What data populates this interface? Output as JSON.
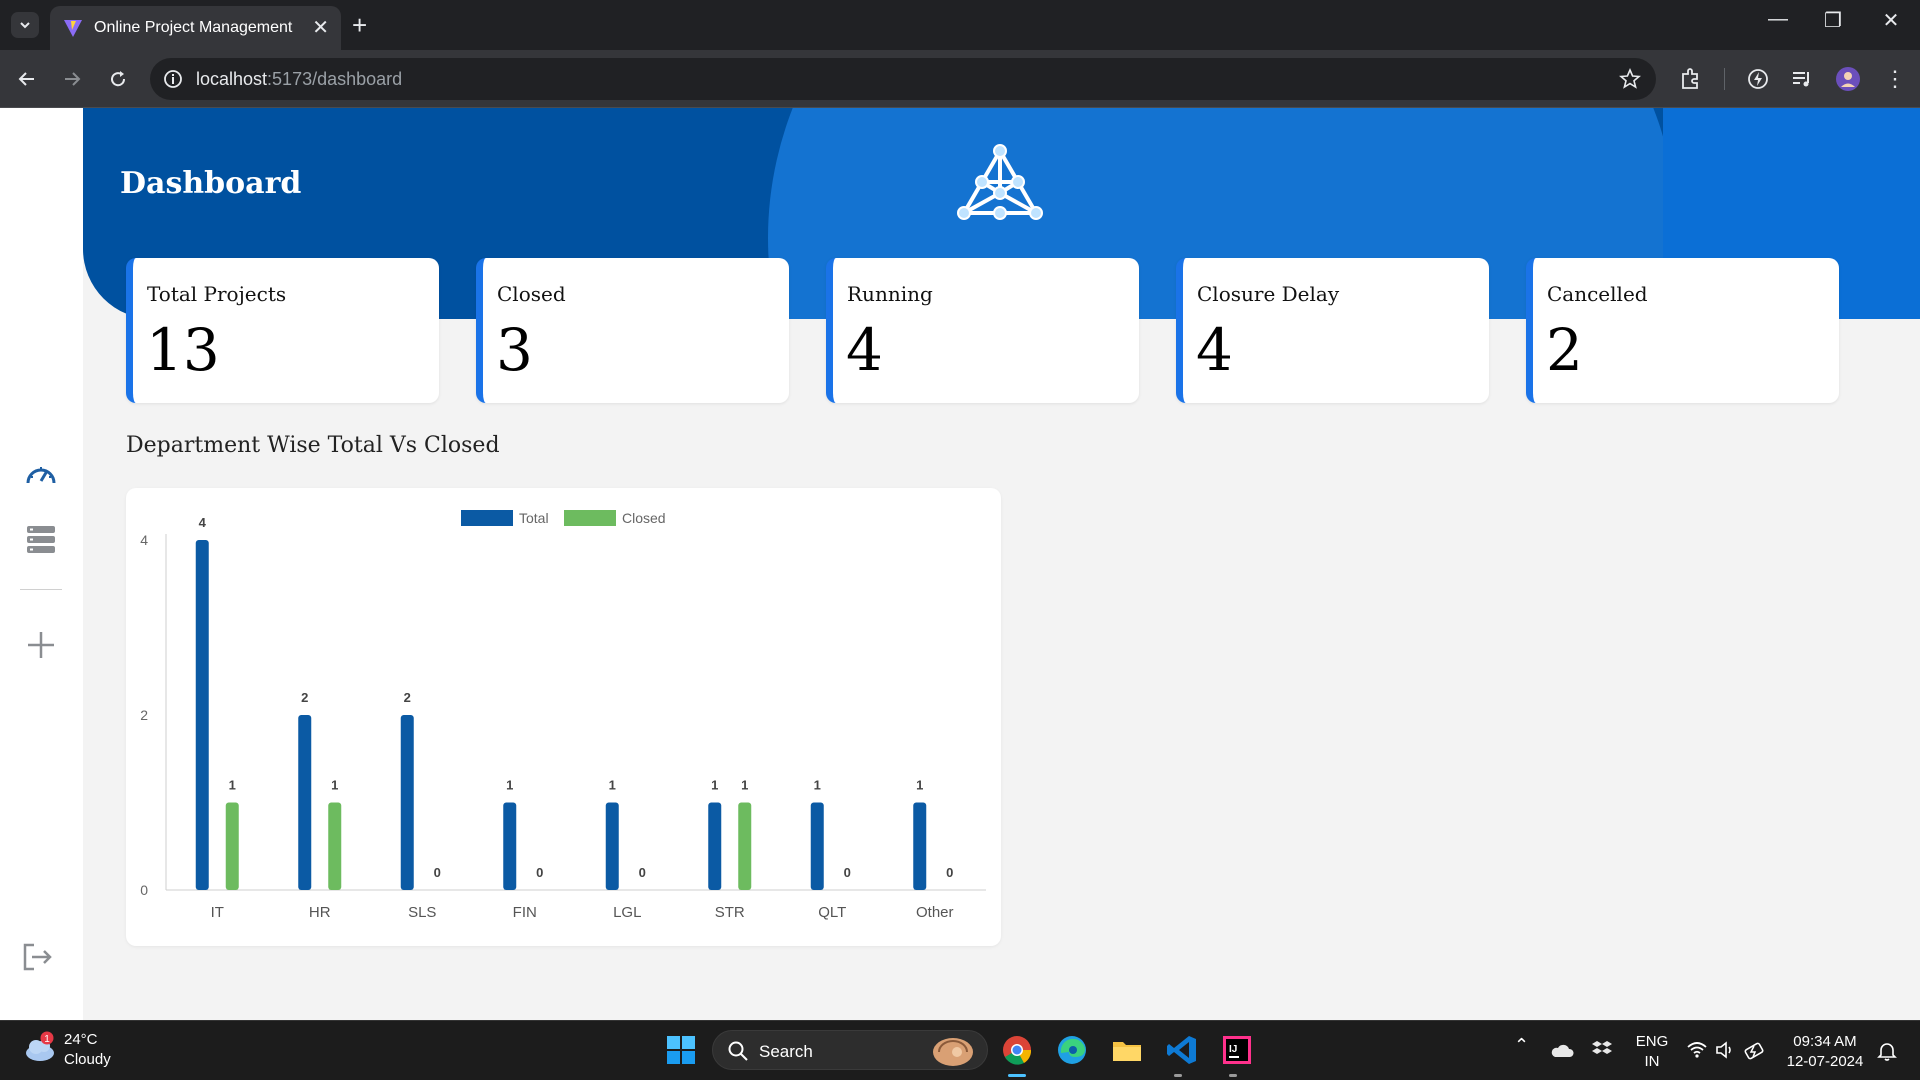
{
  "browser": {
    "tab_title": "Online Project Management",
    "url_host": "localhost",
    "url_rest": ":5173/dashboard"
  },
  "header": {
    "title": "Dashboard"
  },
  "stats": [
    {
      "label": "Total Projects",
      "value": "13"
    },
    {
      "label": "Closed",
      "value": "3"
    },
    {
      "label": "Running",
      "value": "4"
    },
    {
      "label": "Closure Delay",
      "value": "4"
    },
    {
      "label": "Cancelled",
      "value": "2"
    }
  ],
  "sidebar": {
    "icons": [
      "dashboard-gauge-icon",
      "project-list-icon",
      "add-icon",
      "logout-icon"
    ]
  },
  "section": {
    "chart_title": "Department Wise Total Vs Closed"
  },
  "chart_data": {
    "type": "bar",
    "categories": [
      "IT",
      "HR",
      "SLS",
      "FIN",
      "LGL",
      "STR",
      "QLT",
      "Other"
    ],
    "series": [
      {
        "name": "Total",
        "values": [
          4,
          2,
          2,
          1,
          1,
          1,
          1,
          1
        ],
        "color": "#0b5aa4"
      },
      {
        "name": "Closed",
        "values": [
          1,
          1,
          0,
          0,
          0,
          1,
          0,
          0
        ],
        "color": "#6dbb5f"
      }
    ],
    "ylim": [
      0,
      4
    ],
    "yticks": [
      0,
      2,
      4
    ],
    "legend": "top-center",
    "grid": false,
    "data_labels": true
  },
  "taskbar": {
    "weather_badge": "1",
    "temperature": "24°C",
    "condition": "Cloudy",
    "search_label": "Search",
    "lang1": "ENG",
    "lang2": "IN",
    "time": "09:34 AM",
    "date": "12-07-2024"
  },
  "colors": {
    "hero": "#0051a0",
    "accent": "#1a73e8"
  }
}
